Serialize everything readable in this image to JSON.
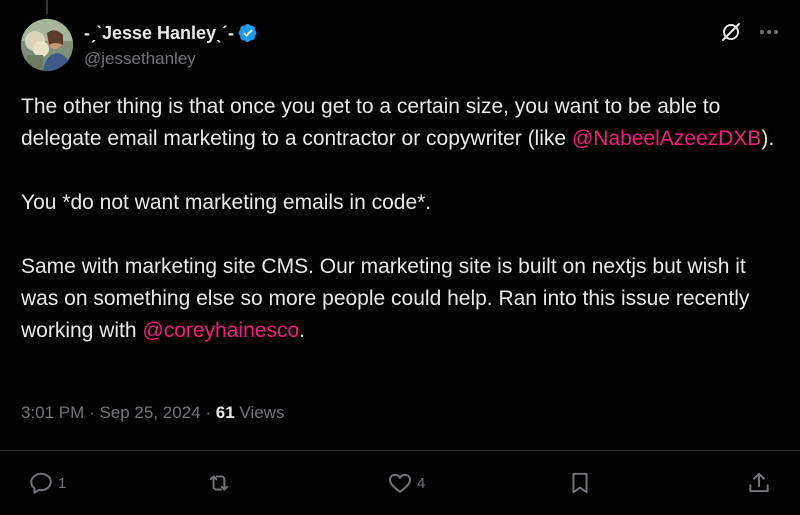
{
  "author": {
    "display_name": "-ˏˋJesse Hanleyˎˊ-",
    "handle": "@jessethanley",
    "verified": true
  },
  "tweet": {
    "line1_pre": "The other thing is that once you get to a certain size, you want to be able to delegate email marketing to a contractor or copywriter (like ",
    "mention1": "@NabeelAzeezDXB",
    "line1_post": ").",
    "line2": "You *do not want marketing emails in code*.",
    "line3_pre": "Same with marketing site CMS. Our marketing site is built on nextjs but wish it was on something else so more people could help. Ran into this issue recently working with ",
    "mention2": "@coreyhainesco",
    "line3_post": "."
  },
  "meta": {
    "time": "3:01 PM",
    "separator": "·",
    "date": "Sep 25, 2024",
    "views_count": "61",
    "views_label": "Views"
  },
  "actions": {
    "replies": "1",
    "reposts": "",
    "likes": "4"
  },
  "colors": {
    "background": "#000000",
    "text": "#e7e9ea",
    "muted": "#71767b",
    "mention": "#f91880",
    "verified": "#1d9bf0",
    "divider": "#2f3336"
  }
}
